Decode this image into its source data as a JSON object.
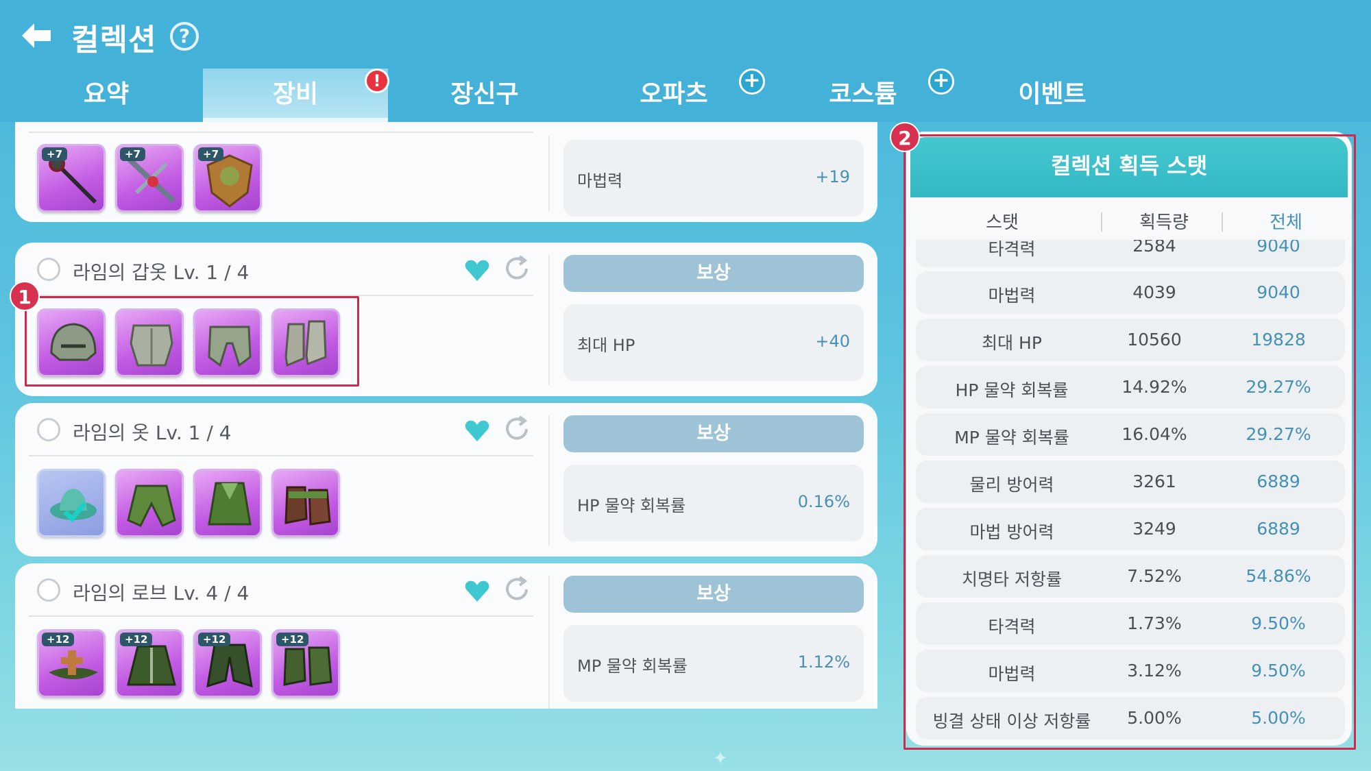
{
  "header": {
    "title": "컬렉션",
    "help_label": "?",
    "tabs": [
      {
        "label": "요약"
      },
      {
        "label": "장비",
        "badge": "!"
      },
      {
        "label": "장신구"
      },
      {
        "label": "오파츠",
        "badge": "+"
      },
      {
        "label": "코스튬",
        "badge": "+"
      },
      {
        "label": "이벤트"
      }
    ],
    "active_tab": "장비"
  },
  "sets": [
    {
      "name": "",
      "items": [
        {
          "icon": "staff-icon",
          "enhance": "+7"
        },
        {
          "icon": "crossbow-icon",
          "enhance": "+7"
        },
        {
          "icon": "shield-icon",
          "enhance": "+7"
        }
      ],
      "reward_stat": {
        "label": "마법력",
        "value": "+19"
      }
    },
    {
      "name": "라임의 갑옷 Lv. 1 / 4",
      "items": [
        {
          "icon": "helmet-icon",
          "enhance": ""
        },
        {
          "icon": "chest-armor-icon",
          "enhance": ""
        },
        {
          "icon": "leg-armor-icon",
          "enhance": ""
        },
        {
          "icon": "boots-icon",
          "enhance": ""
        }
      ],
      "reward_button": "보상",
      "reward_stat": {
        "label": "최대 HP",
        "value": "+40"
      }
    },
    {
      "name": "라임의 옷 Lv. 1 / 4",
      "items": [
        {
          "icon": "hat-icon",
          "enhance": "",
          "obtained": true
        },
        {
          "icon": "robe-top-icon",
          "enhance": ""
        },
        {
          "icon": "skirt-icon",
          "enhance": ""
        },
        {
          "icon": "shoes-icon",
          "enhance": ""
        }
      ],
      "reward_button": "보상",
      "reward_stat": {
        "label": "HP 물약 회복률",
        "value": "0.16%"
      }
    },
    {
      "name": "라임의 로브 Lv. 4 / 4",
      "items": [
        {
          "icon": "wizard-hat-icon",
          "enhance": "+12"
        },
        {
          "icon": "robe-icon",
          "enhance": "+12"
        },
        {
          "icon": "coat-icon",
          "enhance": "+12"
        },
        {
          "icon": "robe-boots-icon",
          "enhance": "+12"
        }
      ],
      "reward_button": "보상",
      "reward_stat": {
        "label": "MP 물약 회복률",
        "value": "1.12%"
      }
    }
  ],
  "annotations": {
    "one": "1",
    "two": "2"
  },
  "stats_panel": {
    "title": "컬렉션 획득 스탯",
    "columns": [
      "스탯",
      "획득량",
      "전체"
    ],
    "rows": [
      {
        "name": "타격력",
        "got": "2584",
        "total": "9040"
      },
      {
        "name": "마법력",
        "got": "4039",
        "total": "9040"
      },
      {
        "name": "최대 HP",
        "got": "10560",
        "total": "19828"
      },
      {
        "name": "HP 물약 회복률",
        "got": "14.92%",
        "total": "29.27%"
      },
      {
        "name": "MP 물약 회복률",
        "got": "16.04%",
        "total": "29.27%"
      },
      {
        "name": "물리 방어력",
        "got": "3261",
        "total": "6889"
      },
      {
        "name": "마법 방어력",
        "got": "3249",
        "total": "6889"
      },
      {
        "name": "치명타 저항률",
        "got": "7.52%",
        "total": "54.86%"
      },
      {
        "name": "타격력",
        "got": "1.73%",
        "total": "9.50%"
      },
      {
        "name": "마법력",
        "got": "3.12%",
        "total": "9.50%"
      },
      {
        "name": "빙결 상태 이상 저항률",
        "got": "5.00%",
        "total": "5.00%"
      }
    ]
  },
  "colors": {
    "header_bg": "#44b1d8",
    "accent_teal": "#33b8c4",
    "reward_button": "#9fc3d6",
    "item_purple": "#c25ae3",
    "annotation_red": "#d02a4b",
    "value_blue": "#4591b6"
  }
}
